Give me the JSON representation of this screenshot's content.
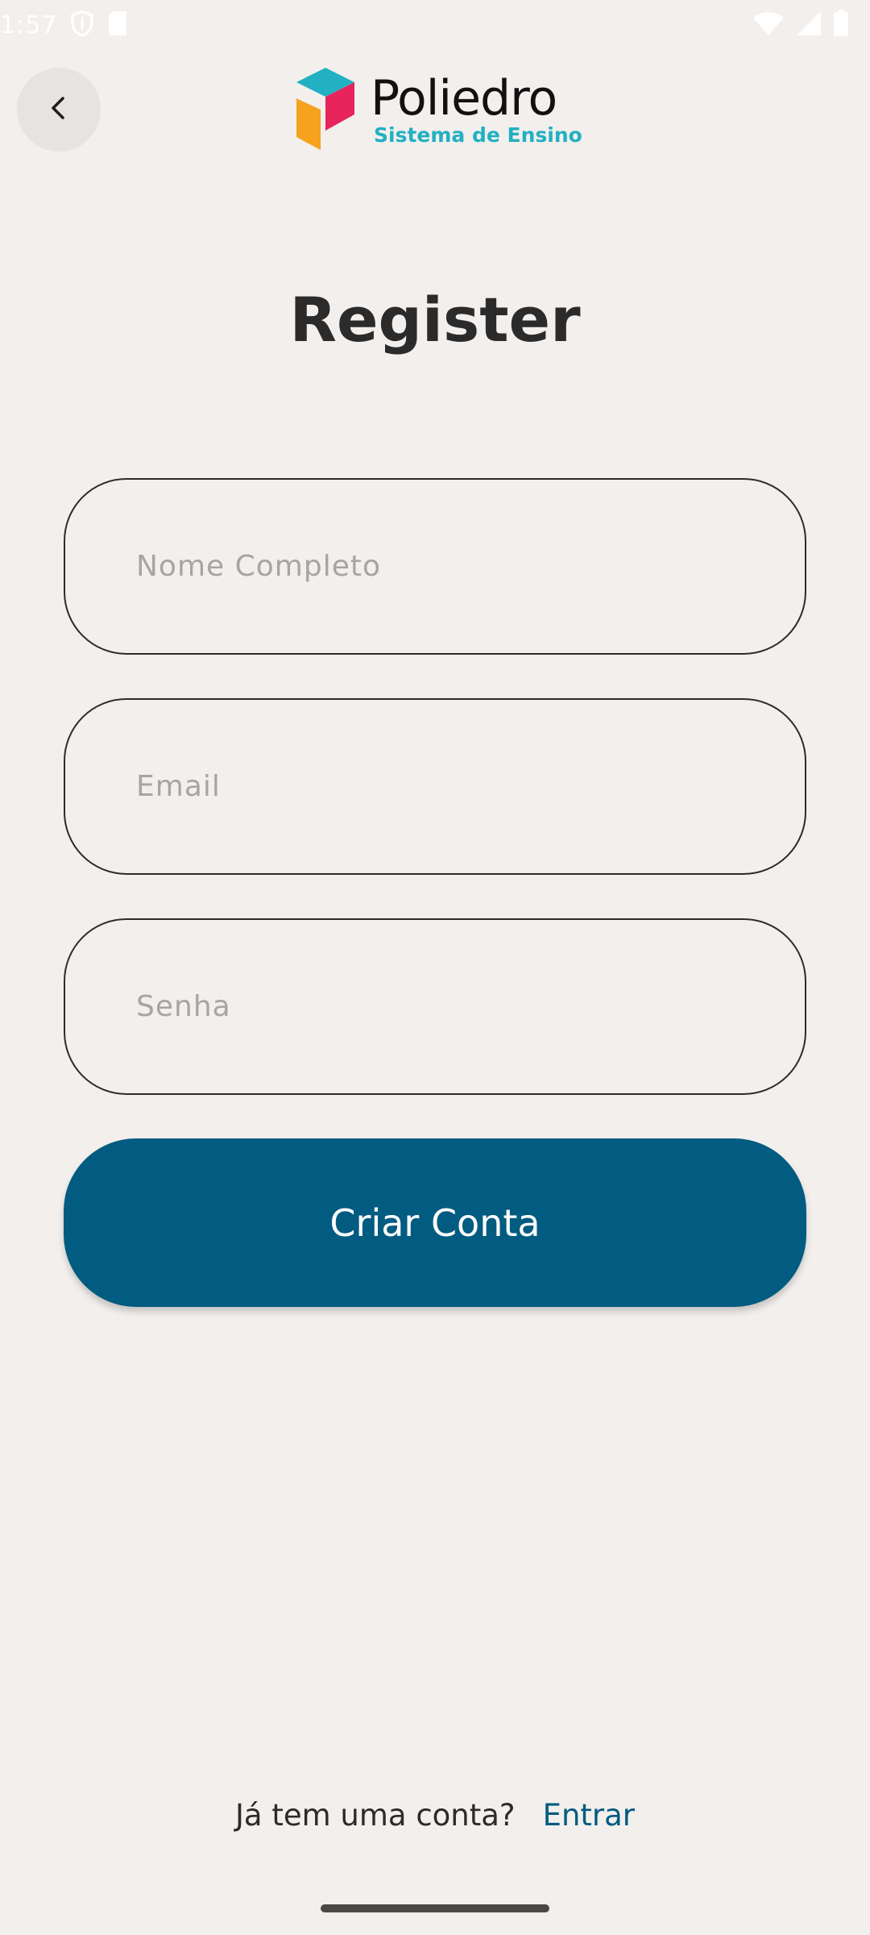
{
  "status_bar": {
    "time": "1:57",
    "icons": [
      "shield-icon",
      "sd-card-icon",
      "wifi-icon",
      "cellular-signal-icon",
      "battery-icon"
    ]
  },
  "header": {
    "back_icon": "chevron-left-icon",
    "logo": {
      "word": "Poliedro",
      "subtitle": "Sistema de Ensino",
      "colors": {
        "teal": "#22b0c2",
        "pink": "#e8245c",
        "orange": "#f6a21c"
      }
    }
  },
  "page": {
    "title": "Register"
  },
  "form": {
    "name_placeholder": "Nome Completo",
    "email_placeholder": "Email",
    "password_placeholder": "Senha",
    "submit_label": "Criar Conta"
  },
  "footer": {
    "prompt": "Já tem uma conta?",
    "link": "Entrar"
  },
  "colors": {
    "background": "#f2efed",
    "primary": "#025b80",
    "text": "#2b2b2b",
    "placeholder": "#a8a4a3"
  }
}
